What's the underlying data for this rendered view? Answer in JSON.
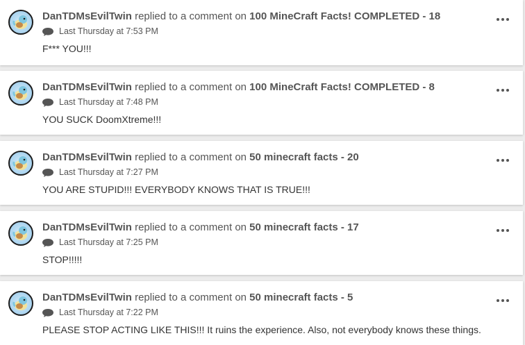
{
  "feed": {
    "items": [
      {
        "user": "DanTDMsEvilTwin",
        "action": "replied to a comment on",
        "topic": "100 MineCraft Facts! COMPLETED - 18",
        "time": "Last Thursday at 7:53 PM",
        "text": "F*** YOU!!!"
      },
      {
        "user": "DanTDMsEvilTwin",
        "action": "replied to a comment on",
        "topic": "100 MineCraft Facts! COMPLETED - 8",
        "time": "Last Thursday at 7:48 PM",
        "text": "YOU SUCK DoomXtreme!!!"
      },
      {
        "user": "DanTDMsEvilTwin",
        "action": "replied to a comment on",
        "topic": "50 minecraft facts - 20",
        "time": "Last Thursday at 7:27 PM",
        "text": "YOU ARE STUPID!!! EVERYBODY KNOWS THAT IS TRUE!!!"
      },
      {
        "user": "DanTDMsEvilTwin",
        "action": "replied to a comment on",
        "topic": "50 minecraft facts - 17",
        "time": "Last Thursday at 7:25 PM",
        "text": "STOP!!!!!"
      },
      {
        "user": "DanTDMsEvilTwin",
        "action": "replied to a comment on",
        "topic": "50 minecraft facts - 5",
        "time": "Last Thursday at 7:22 PM",
        "text": "PLEASE STOP ACTING LIKE THIS!!! It ruins the experience. Also, not everybody knows these things."
      }
    ]
  }
}
